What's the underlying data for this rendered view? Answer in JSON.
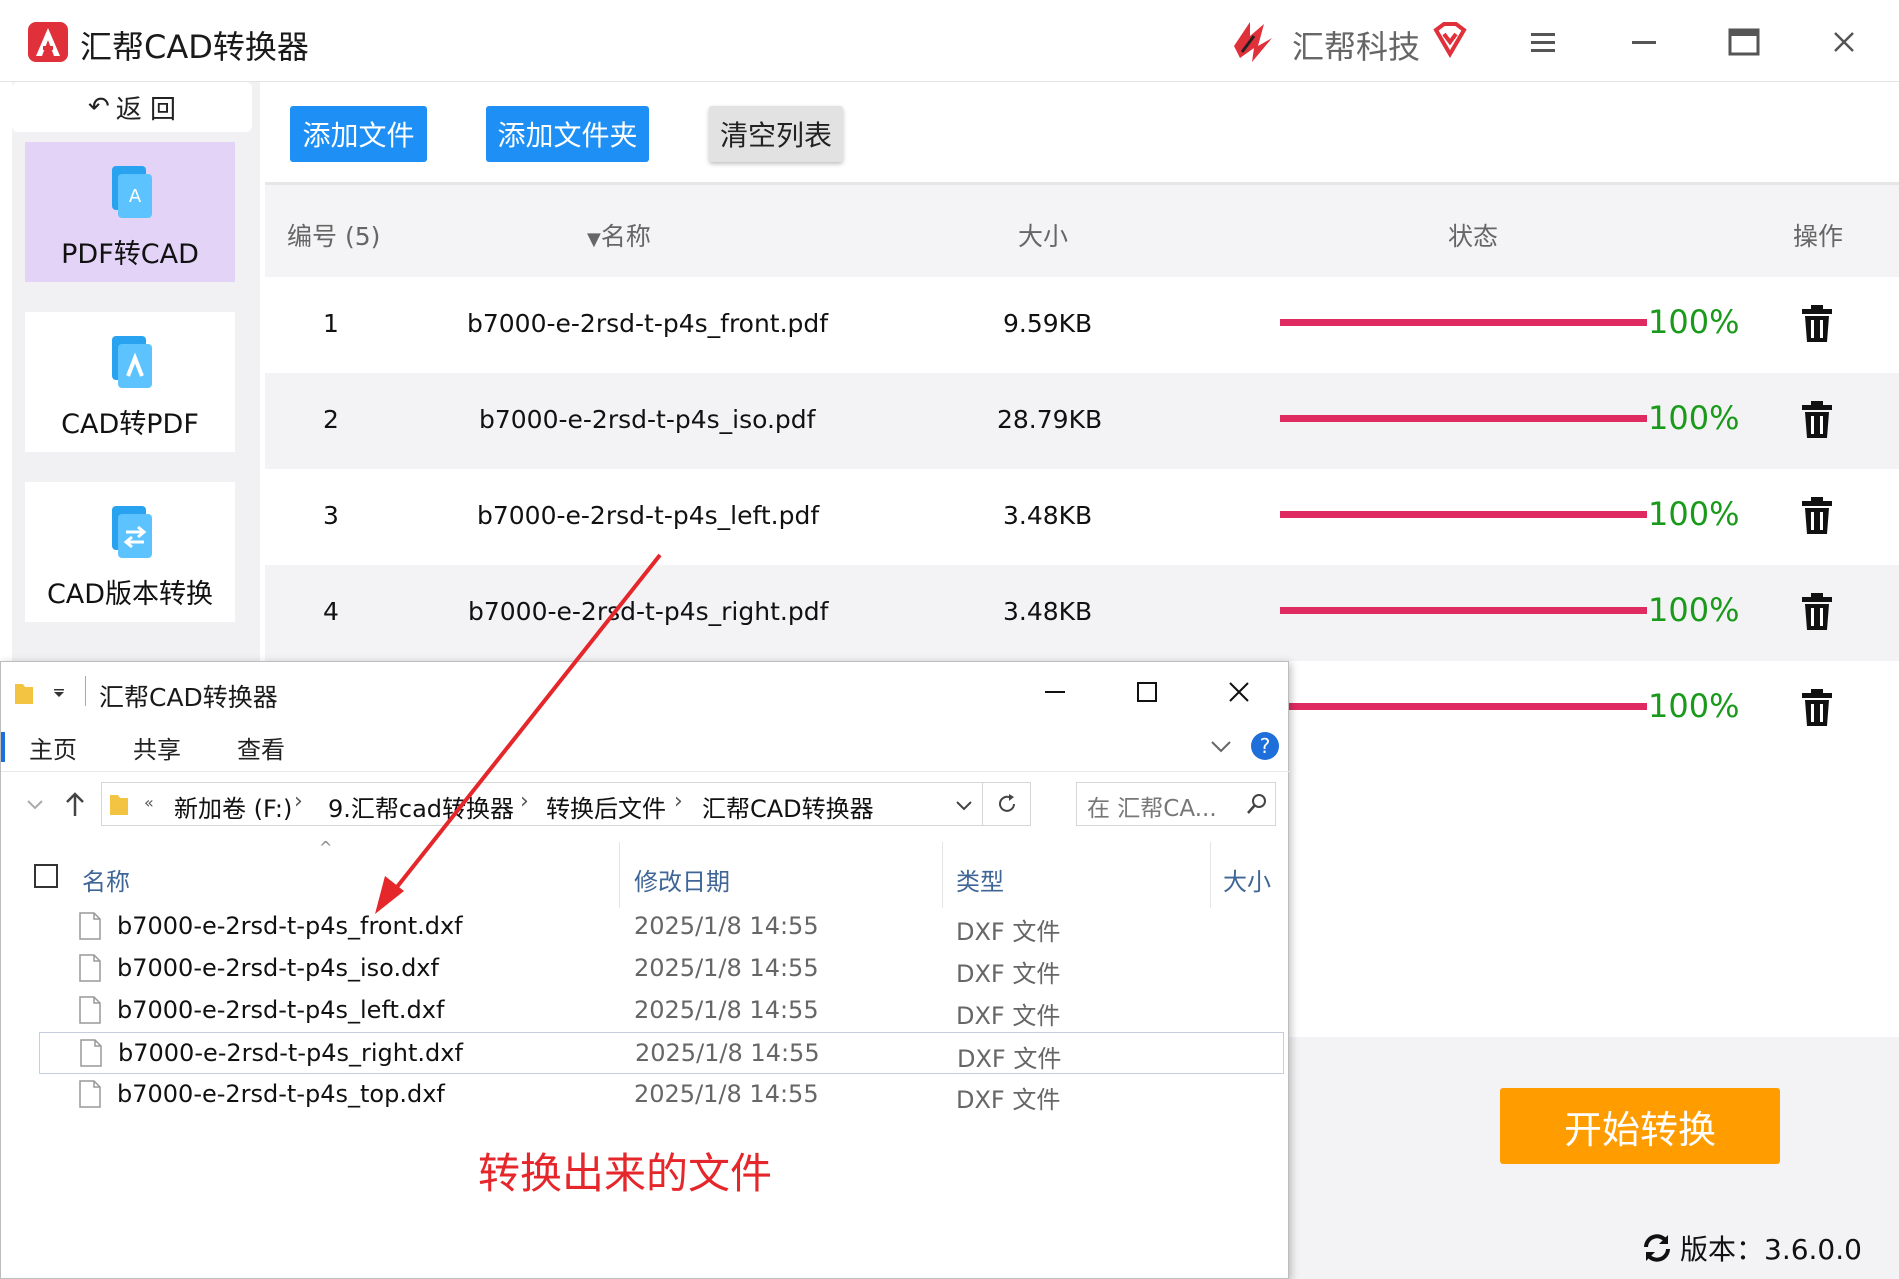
{
  "app": {
    "title": "汇帮CAD转换器",
    "brand": "汇帮科技",
    "colors": {
      "primary_button": "#1e90f5",
      "start_button": "#ff9c00",
      "progress": "#e02a62",
      "percent": "#1a9a1a",
      "active_nav": "#e2d3f7"
    }
  },
  "sidebar": {
    "back_label": "返 回",
    "items": [
      {
        "label": "PDF转CAD",
        "icon": "pdf-to-cad-icon",
        "active": true
      },
      {
        "label": "CAD转PDF",
        "icon": "cad-to-pdf-icon",
        "active": false
      },
      {
        "label": "CAD版本转换",
        "icon": "cad-version-icon",
        "active": false
      }
    ]
  },
  "toolbar": {
    "add_file": "添加文件",
    "add_folder": "添加文件夹",
    "clear_list": "清空列表"
  },
  "table": {
    "headers": {
      "index": "编号 (5)",
      "name": "名称",
      "size": "大小",
      "status": "状态",
      "action": "操作"
    },
    "rows": [
      {
        "index": "1",
        "name": "b7000-e-2rsd-t-p4s_front.pdf",
        "size": "9.59KB",
        "progress": 1.0,
        "percent": "100%"
      },
      {
        "index": "2",
        "name": "b7000-e-2rsd-t-p4s_iso.pdf",
        "size": "28.79KB",
        "progress": 1.0,
        "percent": "100%"
      },
      {
        "index": "3",
        "name": "b7000-e-2rsd-t-p4s_left.pdf",
        "size": "3.48KB",
        "progress": 1.0,
        "percent": "100%"
      },
      {
        "index": "4",
        "name": "b7000-e-2rsd-t-p4s_right.pdf",
        "size": "3.48KB",
        "progress": 1.0,
        "percent": "100%"
      },
      {
        "index": "",
        "name": "",
        "size": "",
        "progress": 1.0,
        "percent": "100%"
      }
    ]
  },
  "start_button": "开始转换",
  "version": "版本：3.6.0.0",
  "explorer": {
    "title": "汇帮CAD转换器",
    "ribbon_tabs": [
      "主页",
      "共享",
      "查看"
    ],
    "breadcrumb": [
      "新加卷 (F:)",
      "9.汇帮cad转换器",
      "转换后文件",
      "汇帮CAD转换器"
    ],
    "search_placeholder": "在 汇帮CA...",
    "columns": {
      "name": "名称",
      "date": "修改日期",
      "type": "类型",
      "size": "大小"
    },
    "files": [
      {
        "name": "b7000-e-2rsd-t-p4s_front.dxf",
        "date": "2025/1/8 14:55",
        "type": "DXF 文件"
      },
      {
        "name": "b7000-e-2rsd-t-p4s_iso.dxf",
        "date": "2025/1/8 14:55",
        "type": "DXF 文件"
      },
      {
        "name": "b7000-e-2rsd-t-p4s_left.dxf",
        "date": "2025/1/8 14:55",
        "type": "DXF 文件"
      },
      {
        "name": "b7000-e-2rsd-t-p4s_right.dxf",
        "date": "2025/1/8 14:55",
        "type": "DXF 文件"
      },
      {
        "name": "b7000-e-2rsd-t-p4s_top.dxf",
        "date": "2025/1/8 14:55",
        "type": "DXF 文件"
      }
    ]
  },
  "annotation": "转换出来的文件"
}
